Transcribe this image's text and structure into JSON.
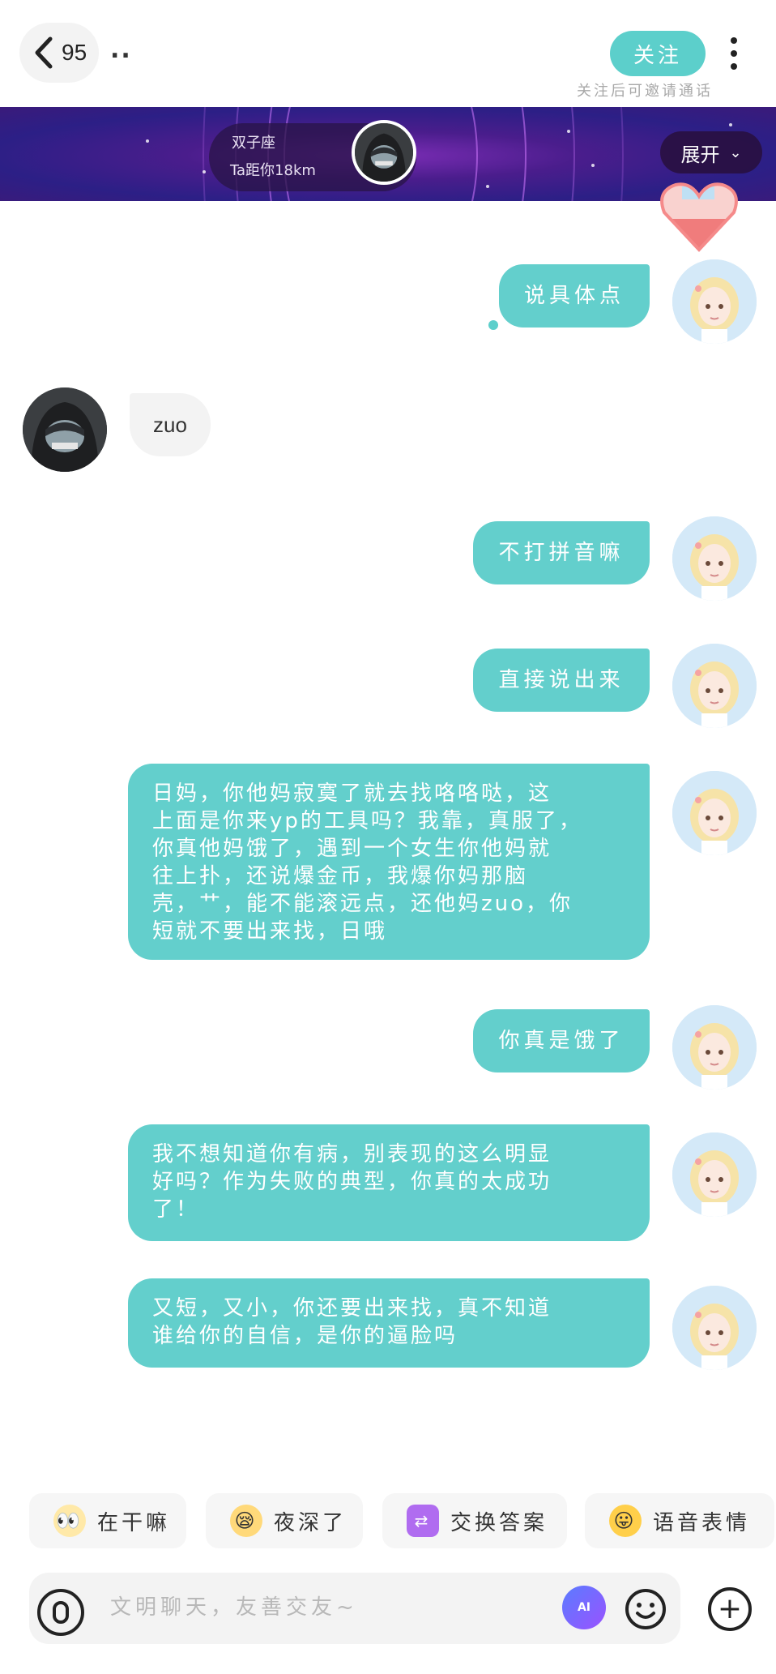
{
  "header": {
    "back_count": "95",
    "nickname": "..",
    "follow_label": "关注",
    "follow_hint": "关注后可邀请通话"
  },
  "banner": {
    "sign": "双子座",
    "distance": "Ta距你18km",
    "expand_label": "展开"
  },
  "messages": [
    {
      "side": "me",
      "text": "说具体点"
    },
    {
      "side": "other",
      "text": "zuo"
    },
    {
      "side": "me",
      "text": "不打拼音嘛"
    },
    {
      "side": "me",
      "text": "直接说出来"
    },
    {
      "side": "me",
      "text": "日妈，你他妈寂寞了就去找咯咯哒，这\n上面是你来yp的工具吗？我靠，真服了，\n你真他妈饿了，遇到一个女生你他妈就\n往上扑，还说爆金币，我爆你妈那脑\n壳，艹，能不能滚远点，还他妈zuo，你\n短就不要出来找，日哦"
    },
    {
      "side": "me",
      "text": "你真是饿了"
    },
    {
      "side": "me",
      "text": "我不想知道你有病，别表现的这么明显\n好吗？作为失败的典型，你真的太成功\n了！"
    },
    {
      "side": "me",
      "text": "又短，又小，你还要出来找，真不知道\n谁给你的自信，是你的逼脸吗"
    }
  ],
  "quick_replies": [
    {
      "label": "在干嘛",
      "icon": "peek-emoji-icon"
    },
    {
      "label": "夜深了",
      "icon": "sleepy-emoji-icon"
    },
    {
      "label": "交换答案",
      "icon": "swap-icon"
    },
    {
      "label": "语音表情",
      "icon": "voice-emoji-icon"
    }
  ],
  "input": {
    "placeholder": "文明聊天，友善交友~",
    "ai_label": "AI"
  },
  "colors": {
    "accent": "#5ccfcb",
    "bubble_out": "#63cfcc",
    "bubble_in": "#f3f3f3",
    "banner": "#3b1a7a"
  }
}
